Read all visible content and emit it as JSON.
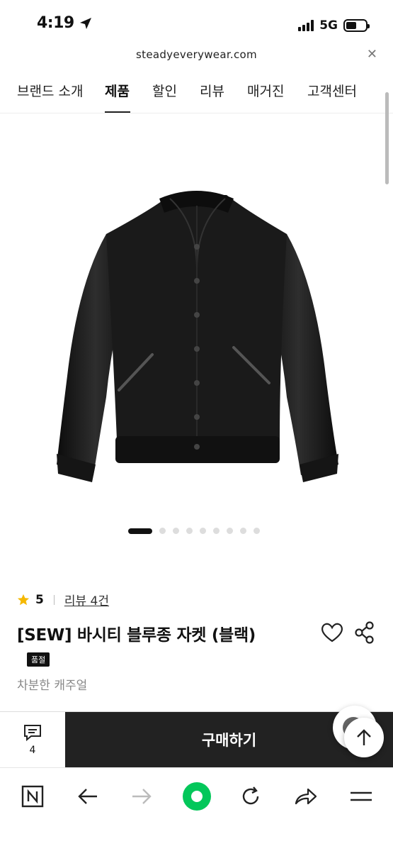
{
  "status_bar": {
    "time": "4:19",
    "network": "5G"
  },
  "browser": {
    "url": "steadyeverywear.com",
    "close_glyph": "✕"
  },
  "nav": {
    "items": [
      {
        "label": "브랜드 소개"
      },
      {
        "label": "제품",
        "active": true
      },
      {
        "label": "할인"
      },
      {
        "label": "리뷰"
      },
      {
        "label": "매거진"
      },
      {
        "label": "고객센터"
      }
    ]
  },
  "carousel": {
    "current_index": 1,
    "total": 9
  },
  "product": {
    "rating": "5",
    "review_link": "리뷰 4건",
    "title": "[SEW] 바시티 블루종 자켓 (블랙)",
    "soldout_badge": "품절",
    "subtitle": "차분한 캐주얼",
    "review_count": "4",
    "buy_label": "구매하기"
  },
  "colors": {
    "buy_button": "#222222",
    "star": "#F5B800",
    "naver_green": "#03C75A",
    "disabled_icon": "#BBBBBB"
  },
  "icons": {
    "status": [
      "location-arrow-icon",
      "signal-icon",
      "battery-icon"
    ],
    "toolbar": [
      "naver-n-icon",
      "back-arrow-icon",
      "forward-arrow-icon",
      "green-dot-icon",
      "reload-icon",
      "share-arrow-icon",
      "menu-icon"
    ],
    "product": [
      "star-icon",
      "heart-icon",
      "share-icon",
      "chat-icon",
      "up-arrow-icon"
    ]
  }
}
